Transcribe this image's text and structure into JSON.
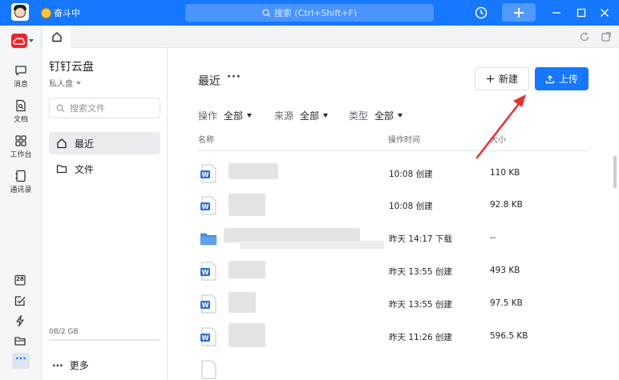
{
  "titlebar": {
    "status": "奋斗中",
    "search_placeholder": "搜索 (Ctrl+Shift+F)"
  },
  "rail": {
    "items": [
      {
        "label": "消息",
        "icon": "message-icon"
      },
      {
        "label": "文档",
        "icon": "document-icon"
      },
      {
        "label": "工作台",
        "icon": "workbench-icon"
      },
      {
        "label": "通讯录",
        "icon": "contacts-icon"
      }
    ],
    "bottom_icons": [
      "calendar-icon",
      "todo-icon",
      "flash-icon",
      "folder-icon"
    ],
    "calendar_day": "28",
    "more": "···"
  },
  "sidebar": {
    "title": "钉钉云盘",
    "subtitle": "私人盘",
    "search_placeholder": "搜索文件",
    "nav": [
      {
        "label": "最近",
        "icon": "home-icon",
        "active": true
      },
      {
        "label": "文件",
        "icon": "folder-icon",
        "active": false
      }
    ],
    "storage": "0B/2 GB",
    "storage_used_fraction": 0,
    "more_dots": "···",
    "more_label": "更多"
  },
  "main": {
    "title": "最近",
    "title_more": "···",
    "new_button": "新建",
    "upload_button": "上传",
    "filters": [
      {
        "label": "操作",
        "value": "全部"
      },
      {
        "label": "来源",
        "value": "全部"
      },
      {
        "label": "类型",
        "value": "全部"
      }
    ],
    "columns": {
      "name": "名称",
      "time": "操作时间",
      "size": "大小"
    },
    "rows": [
      {
        "type": "word",
        "time": "10:08 创建",
        "size": "110 KB"
      },
      {
        "type": "word",
        "time": "10:08 创建",
        "size": "92.8 KB"
      },
      {
        "type": "folder",
        "time": "昨天 14:17 下载",
        "size": "--"
      },
      {
        "type": "word",
        "time": "昨天 13:55 创建",
        "size": "493 KB"
      },
      {
        "type": "word",
        "time": "昨天 13:55 创建",
        "size": "97.5 KB"
      },
      {
        "type": "word",
        "time": "昨天 11:26 创建",
        "size": "596.5 KB"
      }
    ]
  },
  "colors": {
    "accent": "#1677ff",
    "annotation_arrow": "#e8312f",
    "word_icon": "#2b6fd6",
    "folder_icon": "#4a90e2"
  }
}
